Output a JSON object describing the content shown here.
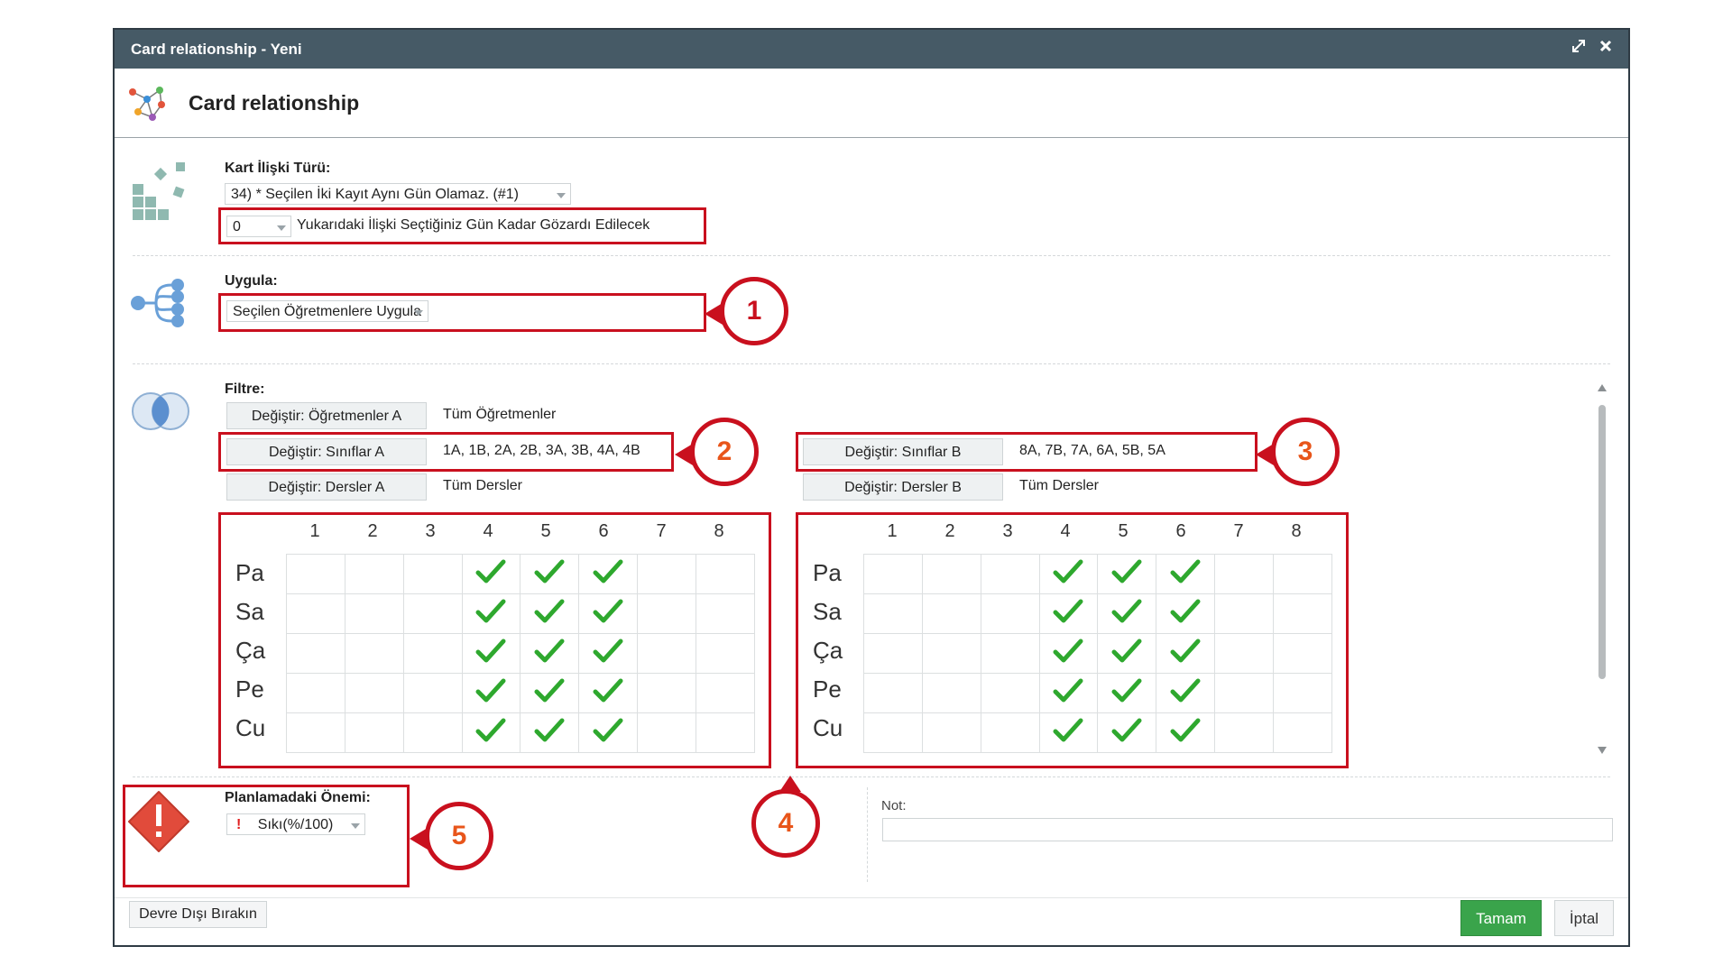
{
  "window": {
    "title": "Card relationship - Yeni",
    "header_title": "Card relationship"
  },
  "kart": {
    "label": "Kart İlişki Türü:",
    "type_value": "34) * Seçilen İki Kayıt Aynı Gün Olamaz. (#1)",
    "days_value": "0",
    "days_text": "Yukarıdaki İlişki Seçtiğiniz Gün Kadar Gözardı Edilecek"
  },
  "uygula": {
    "label": "Uygula:",
    "value": "Seçilen Öğretmenlere Uygula"
  },
  "filtre": {
    "label": "Filtre:",
    "left": [
      {
        "button": "Değiştir: Öğretmenler A",
        "value": "Tüm Öğretmenler"
      },
      {
        "button": "Değiştir: Sınıflar A",
        "value": "1A, 1B, 2A, 2B, 3A, 3B, 4A, 4B"
      },
      {
        "button": "Değiştir: Dersler A",
        "value": "Tüm Dersler"
      }
    ],
    "right": [
      {
        "button": "Değiştir: Sınıflar B",
        "value": "8A, 7B, 7A, 6A, 5B, 5A"
      },
      {
        "button": "Değiştir: Dersler B",
        "value": "Tüm Dersler"
      }
    ]
  },
  "timetable": {
    "periods": [
      "1",
      "2",
      "3",
      "4",
      "5",
      "6",
      "7",
      "8"
    ],
    "days": [
      "Pa",
      "Sa",
      "Ça",
      "Pe",
      "Cu"
    ],
    "checked_periods": [
      4,
      5,
      6
    ]
  },
  "onem": {
    "label": "Planlamadaki Önemi:",
    "icon": "!",
    "value": "Sıkı(%/100)"
  },
  "not": {
    "label": "Not:",
    "value": ""
  },
  "footer": {
    "disable": "Devre Dışı Bırakın",
    "ok": "Tamam",
    "cancel": "İptal"
  },
  "callouts": [
    "1",
    "2",
    "3",
    "4",
    "5"
  ],
  "colors": {
    "titlebar": "#465a66",
    "callout": "#c9101e",
    "ok": "#3aa44b",
    "check": "#2ea82e"
  }
}
